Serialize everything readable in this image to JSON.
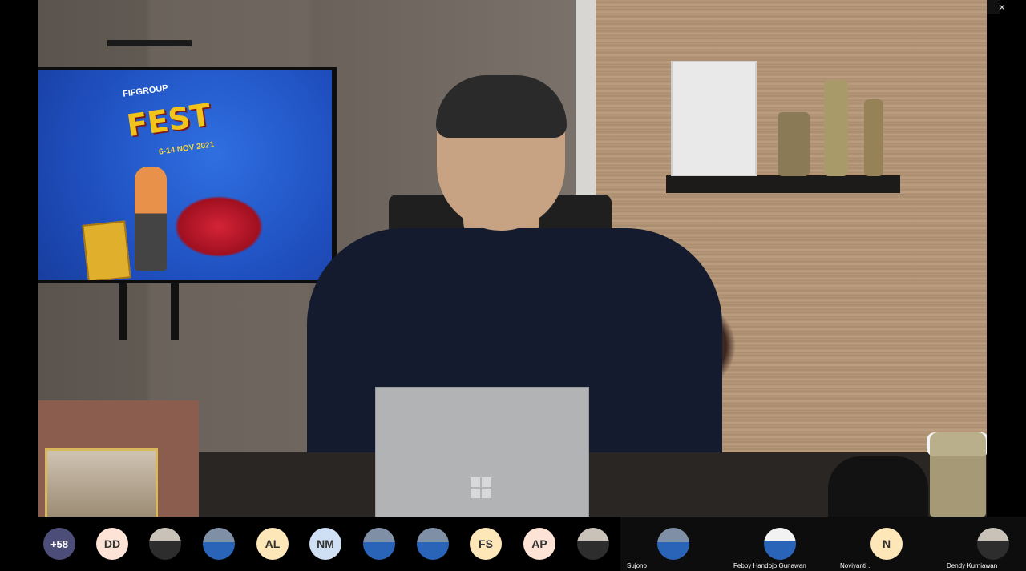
{
  "window": {
    "controls": {
      "minimize": "—",
      "restore": "❐",
      "close": "✕"
    }
  },
  "video": {
    "tv_screen": {
      "brand": "FIFGROUP",
      "title": "FEST",
      "dates": "6-14 NOV 2021"
    }
  },
  "gallery_strip": {
    "avatars": [
      {
        "label": "+58",
        "kind": "more"
      },
      {
        "label": "DD",
        "bg": "#fde2d6"
      },
      {
        "label": "",
        "kind": "photo2"
      },
      {
        "label": "",
        "kind": "photo"
      },
      {
        "label": "AL",
        "bg": "#fde7b8"
      },
      {
        "label": "NM",
        "bg": "#cfe0f5"
      },
      {
        "label": "",
        "kind": "photo"
      },
      {
        "label": "",
        "kind": "photo"
      },
      {
        "label": "FS",
        "bg": "#fde7b8"
      },
      {
        "label": "AP",
        "bg": "#fde2d6"
      },
      {
        "label": "",
        "kind": "photo2"
      }
    ],
    "tiles": [
      {
        "name": "Sujono",
        "label": ""
      },
      {
        "name": "Febby Handojo Gunawan",
        "label": ""
      },
      {
        "name": "Noviyanti .",
        "label": "N"
      },
      {
        "name": "Dendy Kurniawan",
        "label": ""
      }
    ]
  }
}
